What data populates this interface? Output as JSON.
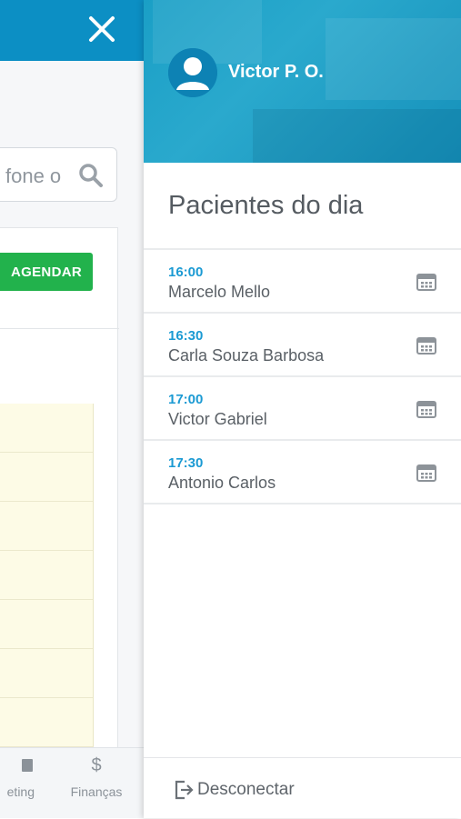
{
  "background_app": {
    "search": {
      "placeholder": "fone o"
    },
    "schedule_button_label": "AGENDAR",
    "nav": [
      {
        "label": "eting",
        "icon": "marketing-icon"
      },
      {
        "label": "Finanças",
        "icon": "dollar-icon"
      }
    ]
  },
  "drawer": {
    "user": {
      "name": "Victor P. O.",
      "avatar_icon": "user-icon"
    },
    "section_title": "Pacientes do dia",
    "patients": [
      {
        "time": "16:00",
        "name": "Marcelo Mello"
      },
      {
        "time": "16:30",
        "name": "Carla Souza Barbosa"
      },
      {
        "time": "17:00",
        "name": "Victor Gabriel"
      },
      {
        "time": "17:30",
        "name": "Antonio Carlos"
      }
    ],
    "logout_label": "Desconectar"
  },
  "colors": {
    "brand_blue": "#0c8fc4",
    "accent_time": "#1b9ad3",
    "schedule_green": "#22b24c"
  }
}
